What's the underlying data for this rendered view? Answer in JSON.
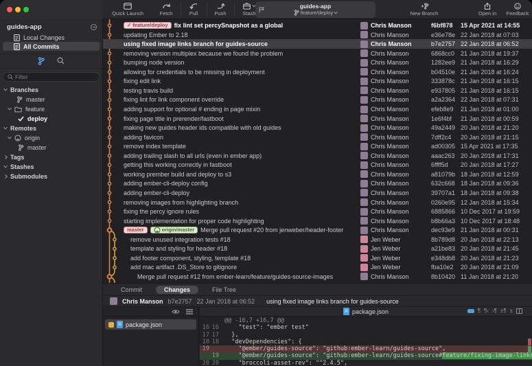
{
  "window": {
    "title": "guides-app"
  },
  "toolbar": {
    "quick_launch": "Quick Launch",
    "fetch": "Fetch",
    "pull": "Pull",
    "push": "Push",
    "stash": "Stash",
    "repo_title": "guides-app",
    "current_branch": "feature/deploy",
    "new_branch": "New Branch",
    "open_in": "Open in",
    "feedback": "Feedback"
  },
  "sidebar": {
    "repo": "guides-app",
    "items": [
      {
        "label": "Local Changes",
        "selected": false
      },
      {
        "label": "All Commits",
        "selected": true
      }
    ],
    "filter_placeholder": "Filter",
    "tree": [
      {
        "label": "Branches",
        "level": 0,
        "chev": "down",
        "icon": null,
        "section": true
      },
      {
        "label": "master",
        "level": 1,
        "chev": null,
        "icon": "branch"
      },
      {
        "label": "feature",
        "level": 1,
        "chev": "down",
        "icon": "folder"
      },
      {
        "label": "deploy",
        "level": 2,
        "chev": null,
        "icon": "check",
        "bold": true
      },
      {
        "label": "Remotes",
        "level": 0,
        "chev": "down",
        "icon": null,
        "section": true
      },
      {
        "label": "origin",
        "level": 1,
        "chev": "down",
        "icon": "github"
      },
      {
        "label": "master",
        "level": 2,
        "chev": null,
        "icon": "branch"
      },
      {
        "label": "Tags",
        "level": 0,
        "chev": "right",
        "icon": null,
        "section": true
      },
      {
        "label": "Stashes",
        "level": 0,
        "chev": "down",
        "icon": null,
        "section": true
      },
      {
        "label": "Submodules",
        "level": 0,
        "chev": "right",
        "icon": null,
        "section": true
      }
    ]
  },
  "avatar_colors": {
    "Chris Manson": "#8f7d96",
    "Jen Weber": "#cf8499",
    "": "#6a5a66"
  },
  "commits": [
    {
      "message": "fix lint set percySnapshot as a global",
      "author": "Chris Manson",
      "hash": "f6bf878",
      "date": "15 Apr 2021 at 14:55",
      "head": true,
      "badges": [
        {
          "label": "feature/deploy",
          "style": "pink",
          "check": true
        }
      ],
      "lane": 0,
      "dot": "normal",
      "indent": 0
    },
    {
      "message": "updating Ember to 2.18",
      "author": "Chris Manson",
      "hash": "e36e78e",
      "date": "22 Jan 2018 at 07:03",
      "lane": 0,
      "dot": "normal",
      "indent": 0
    },
    {
      "message": "using fixed image links branch for guides-source",
      "author": "Chris Manson",
      "hash": "b7e2757",
      "date": "22 Jan 2018 at 06:52",
      "selected": true,
      "lane": 0,
      "dot": "normal",
      "indent": 0
    },
    {
      "message": "removing version multiplex because we found the problem",
      "author": "Chris Manson",
      "hash": "6868cc0",
      "date": "21 Jan 2018 at 19:37",
      "lane": 0,
      "dot": "normal",
      "indent": 0
    },
    {
      "message": "bumping node version",
      "author": "Chris Manson",
      "hash": "1282ee9",
      "date": "21 Jan 2018 at 16:29",
      "lane": 0,
      "dot": "normal",
      "indent": 0
    },
    {
      "message": "allowing for credentials to be missing in deployment",
      "author": "Chris Manson",
      "hash": "b04510e",
      "date": "21 Jan 2018 at 16:24",
      "lane": 0,
      "dot": "normal",
      "indent": 0
    },
    {
      "message": "fixing edit link",
      "author": "Chris Manson",
      "hash": "333878c",
      "date": "21 Jan 2018 at 16:15",
      "lane": 0,
      "dot": "normal",
      "indent": 0
    },
    {
      "message": "testing travis build",
      "author": "Chris Manson",
      "hash": "e937805",
      "date": "21 Jan 2018 at 16:15",
      "lane": 0,
      "dot": "normal",
      "indent": 0
    },
    {
      "message": "fixing lint for link component override",
      "author": "Chris Manson",
      "hash": "a2a2364",
      "date": "22 Jan 2018 at 07:31",
      "lane": 0,
      "dot": "normal",
      "indent": 0
    },
    {
      "message": "adding support for optional # ending in page mixin",
      "author": "Chris Manson",
      "hash": "efeb8e9",
      "date": "21 Jan 2018 at 01:00",
      "lane": 0,
      "dot": "normal",
      "indent": 0
    },
    {
      "message": "fixing page title in prerender/fastboot",
      "author": "Chris Manson",
      "hash": "1e6f4bf",
      "date": "21 Jan 2018 at 00:59",
      "lane": 0,
      "dot": "normal",
      "indent": 0
    },
    {
      "message": "making new guides header ids compatible with old guides",
      "author": "Chris Manson",
      "hash": "49a2449",
      "date": "20 Jan 2018 at 21:20",
      "lane": 0,
      "dot": "normal",
      "indent": 0
    },
    {
      "message": "adding favicon",
      "author": "Chris Manson",
      "hash": "7dff2c4",
      "date": "20 Jan 2018 at 21:15",
      "lane": 0,
      "dot": "normal",
      "indent": 0
    },
    {
      "message": "remove index template",
      "author": "Chris Manson",
      "hash": "ad00305",
      "date": "15 Apr 2021 at 17:35",
      "lane": 0,
      "dot": "normal",
      "indent": 0
    },
    {
      "message": "adding trailing slash to all urls (even in ember app)",
      "author": "Chris Manson",
      "hash": "aaac263",
      "date": "20 Jan 2018 at 17:31",
      "lane": 0,
      "dot": "normal",
      "indent": 0
    },
    {
      "message": "getting this working correctly in fastboot",
      "author": "Chris Manson",
      "hash": "6ffff5d",
      "date": "20 Jan 2018 at 17:27",
      "lane": 0,
      "dot": "normal",
      "indent": 0
    },
    {
      "message": "working prember build and deploy to s3",
      "author": "Chris Manson",
      "hash": "a81079b",
      "date": "18 Jan 2018 at 12:59",
      "lane": 0,
      "dot": "normal",
      "indent": 0
    },
    {
      "message": "adding ember-cli-deploy config",
      "author": "Chris Manson",
      "hash": "632c668",
      "date": "18 Jan 2018 at 09:36",
      "lane": 0,
      "dot": "normal",
      "indent": 0
    },
    {
      "message": "adding ember-cli-deploy",
      "author": "Chris Manson",
      "hash": "39707a1",
      "date": "18 Jan 2018 at 09:38",
      "lane": 0,
      "dot": "normal",
      "indent": 0
    },
    {
      "message": "removing images from highlighting branch",
      "author": "Chris Manson",
      "hash": "0260e95",
      "date": "12 Jan 2018 at 15:34",
      "lane": 0,
      "dot": "normal",
      "indent": 0
    },
    {
      "message": "fixing the percy ignore rules",
      "author": "Chris Manson",
      "hash": "6885866",
      "date": "10 Dec 2017 at 19:59",
      "lane": 0,
      "dot": "normal",
      "indent": 0
    },
    {
      "message": "starting implementation for proper code highlighting",
      "author": "Chris Manson",
      "hash": "b8b66a3",
      "date": "10 Dec 2017 at 18:48",
      "lane": 0,
      "dot": "normal",
      "indent": 0
    },
    {
      "message": "Merge pull request #20 from jenweber/header-footer",
      "author": "Chris Manson",
      "hash": "dec93e9",
      "date": "21 Jan 2018 at 00:31",
      "badges": [
        {
          "label": "master",
          "style": "pink"
        },
        {
          "label": "origin/master",
          "style": "green",
          "github": true
        }
      ],
      "lane": 0,
      "dot": "merge",
      "indent": 0
    },
    {
      "message": "remove unused integration tests #18",
      "author": "Jen Weber",
      "hash": "8b789d8",
      "date": "20 Jan 2018 at 22:13",
      "lane": 1,
      "dot": "normal",
      "indent": 1
    },
    {
      "message": "template and styling for header #18",
      "author": "Jen Weber",
      "hash": "a21be83",
      "date": "20 Jan 2018 at 21:45",
      "lane": 1,
      "dot": "normal",
      "indent": 1
    },
    {
      "message": "add footer component, styling, template #18",
      "author": "Jen Weber",
      "hash": "e348db8",
      "date": "20 Jan 2018 at 21:23",
      "lane": 1,
      "dot": "normal",
      "indent": 1
    },
    {
      "message": "add mac artifact .DS_Store to gitignore",
      "author": "Jen Weber",
      "hash": "fba10e2",
      "date": "20 Jan 2018 at 21:09",
      "lane": 1,
      "dot": "normal",
      "indent": 1
    },
    {
      "message": "Merge pull request #12 from ember-learn/feature/guides-source-images",
      "author": "Chris Manson",
      "hash": "8b10420",
      "date": "11 Jan 2018 at 21:20",
      "lane": 0,
      "dot": "merge",
      "indent": 2
    },
    {
      "message": "",
      "author": "",
      "hash": "",
      "date": "",
      "lane": 0,
      "dot": "normal",
      "indent": 0,
      "partial": true
    }
  ],
  "graph": {
    "branch": {
      "from": 22,
      "to": 27
    },
    "colors": {
      "main": "#e0823c",
      "branch": "#d9a13a"
    }
  },
  "bottom": {
    "tabs": [
      {
        "label": "Commit"
      },
      {
        "label": "Changes",
        "active": true
      },
      {
        "label": "File Tree"
      }
    ],
    "detail": {
      "author": "Chris Manson",
      "hash": "b7e2757",
      "date": "22 Jan 2018 at 06:52",
      "message": "using fixed image links branch for guides-source"
    },
    "files": [
      {
        "name": "package.json",
        "status": "modified",
        "selected": true
      }
    ],
    "diff": {
      "file": "package.json",
      "hunk": "@@ -16,7 +16,7 @@",
      "lines": [
        {
          "old": "16",
          "new": "16",
          "type": "context",
          "text": "    \"test\": \"ember test\""
        },
        {
          "old": "17",
          "new": "17",
          "type": "context",
          "text": "  },"
        },
        {
          "old": "18",
          "new": "18",
          "type": "context",
          "text": "  \"devDependencies\": {"
        },
        {
          "old": "19",
          "new": "",
          "type": "removed",
          "text": "    \"@ember/guides-source\": \"github:ember-learn/guides-source\","
        },
        {
          "old": "",
          "new": "19",
          "type": "added",
          "text_pre": "    \"@ember/guides-source\": \"github:ember-learn/guides-source#",
          "text_hl": "feature/fixing-image-links",
          "text_post": "\","
        },
        {
          "old": "20",
          "new": "20",
          "type": "context",
          "text": "    \"broccoli-asset-rev\": \"^2.4.5\","
        }
      ]
    }
  }
}
